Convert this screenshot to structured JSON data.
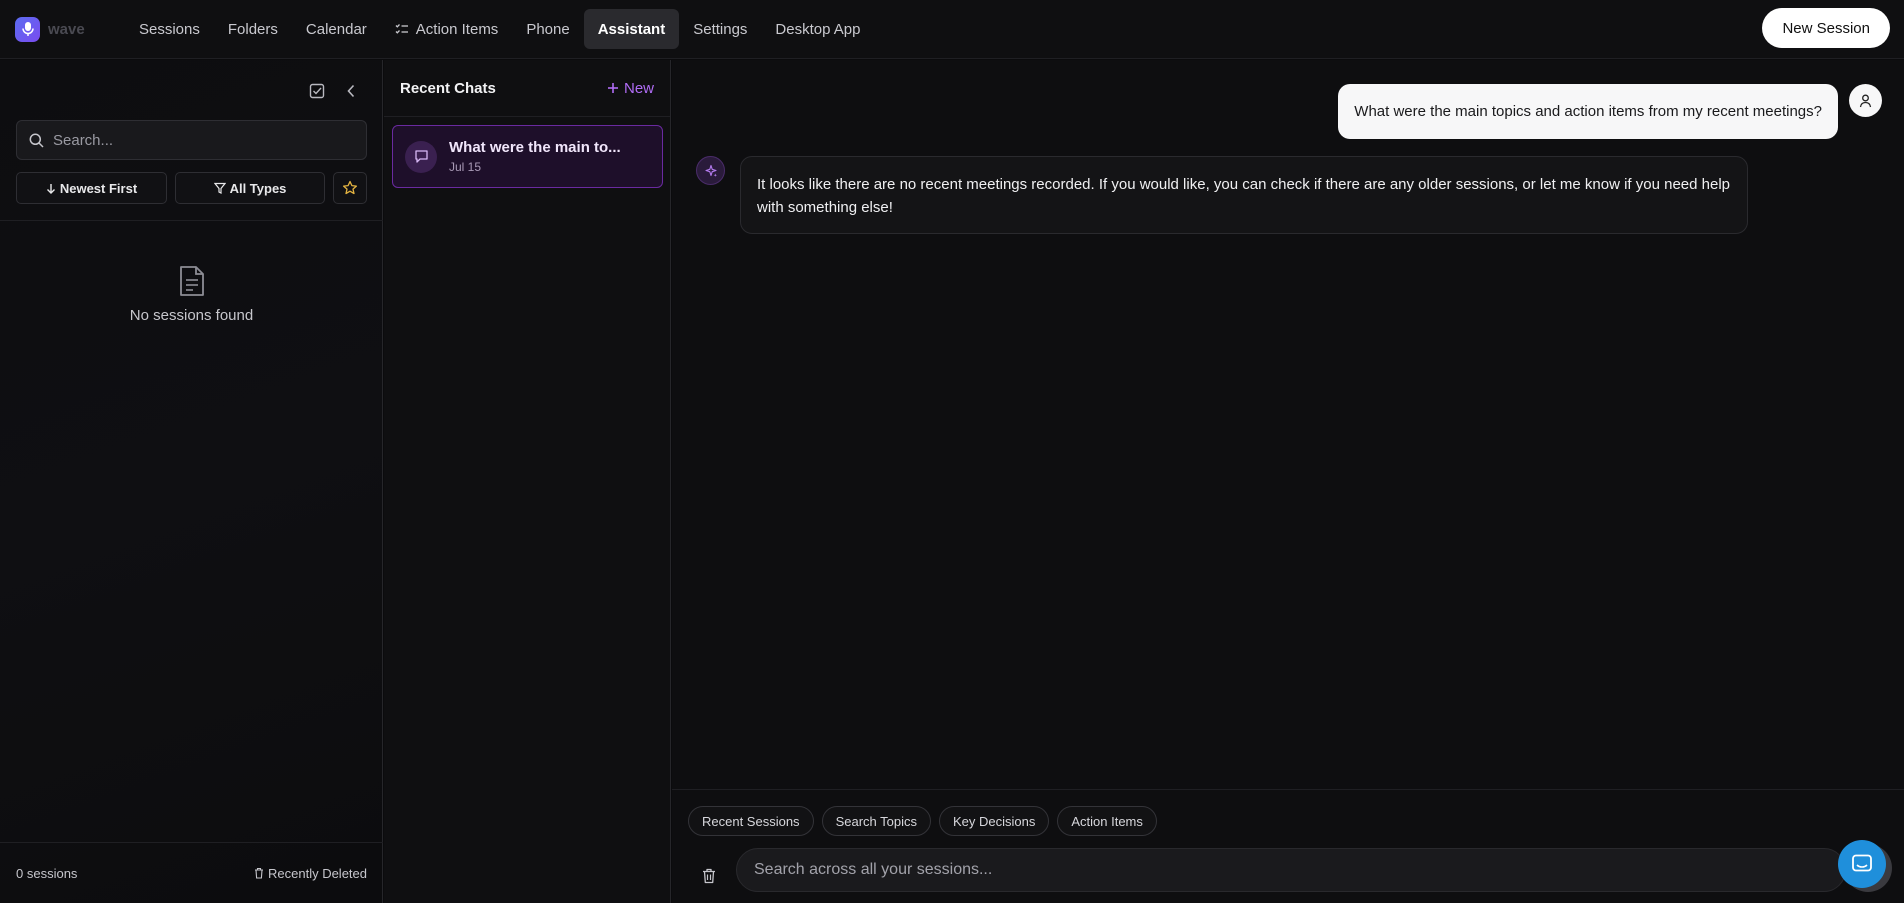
{
  "app": {
    "name": "wave"
  },
  "nav": {
    "items": [
      {
        "label": "Sessions"
      },
      {
        "label": "Folders"
      },
      {
        "label": "Calendar"
      },
      {
        "label": "Action Items",
        "icon": "list-check-icon"
      },
      {
        "label": "Phone"
      },
      {
        "label": "Assistant",
        "active": true
      },
      {
        "label": "Settings"
      },
      {
        "label": "Desktop App"
      }
    ],
    "new_session_label": "New Session"
  },
  "sessions_panel": {
    "search_placeholder": "Search...",
    "sort_label": "Newest First",
    "type_filter_label": "All Types",
    "empty_label": "No sessions found",
    "count_label": "0 sessions",
    "recently_deleted_label": "Recently Deleted"
  },
  "chats_panel": {
    "title": "Recent Chats",
    "new_label": "New",
    "items": [
      {
        "title": "What were the main to...",
        "date": "Jul 15"
      }
    ]
  },
  "conversation": {
    "user_message": "What were the main topics and action items from my recent meetings?",
    "assistant_message": "It looks like there are no recent meetings recorded. If you would like, you can check if there are any older sessions, or let me know if you need help with something else!"
  },
  "composer": {
    "chips": [
      "Recent Sessions",
      "Search Topics",
      "Key Decisions",
      "Action Items"
    ],
    "placeholder": "Search across all your sessions..."
  },
  "colors": {
    "accent": "#b06cf5",
    "help_bubble": "#1f8fdb",
    "background": "#0e0e10"
  }
}
